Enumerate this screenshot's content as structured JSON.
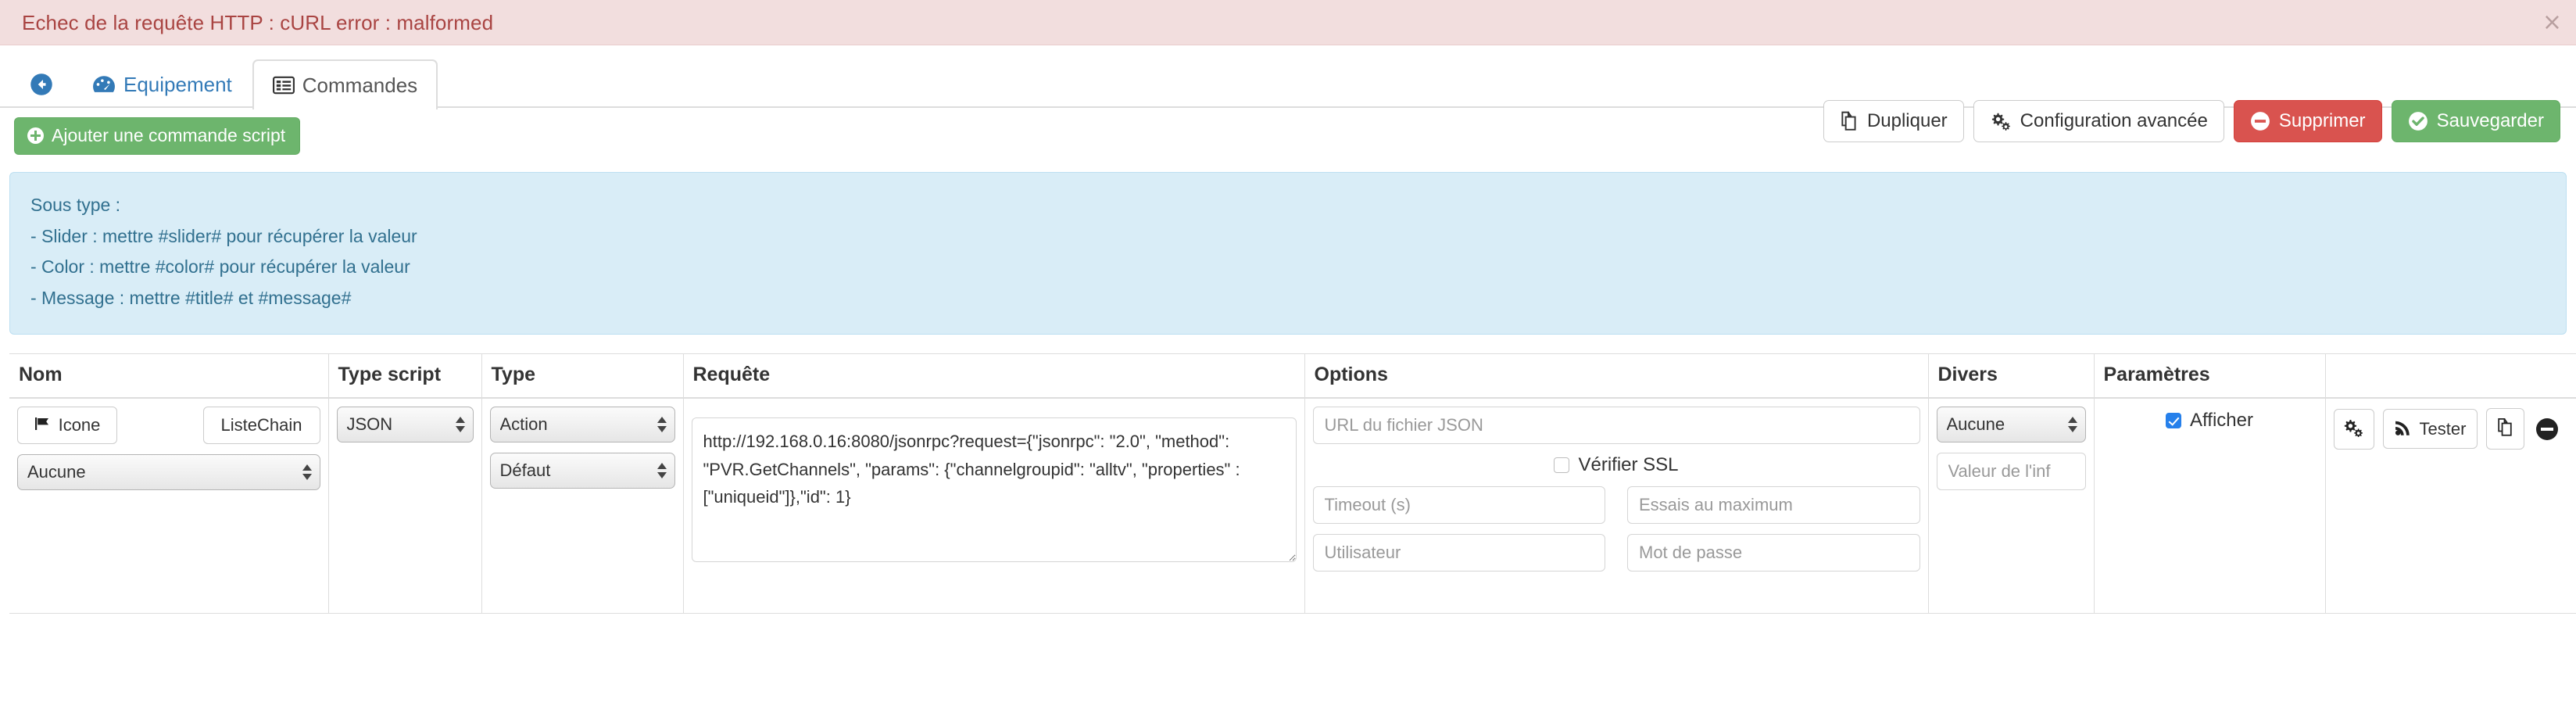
{
  "alert": {
    "message": "Echec de la requête HTTP : cURL error : malformed",
    "close_label": "×",
    "bg_color": "#f2dede",
    "text_color": "#a94442"
  },
  "tabs": [
    {
      "name": "back",
      "label": "",
      "icon": "arrow-circle-left-icon",
      "active": false
    },
    {
      "name": "equipement",
      "label": "Equipement",
      "icon": "dashboard-icon",
      "active": false
    },
    {
      "name": "commandes",
      "label": "Commandes",
      "icon": "list-alt-icon",
      "active": true
    }
  ],
  "header_actions": [
    {
      "name": "dupliquer",
      "label": "Dupliquer",
      "icon": "copy-icon",
      "style": "default"
    },
    {
      "name": "configuration-avancee",
      "label": "Configuration avancée",
      "icon": "cogs-icon",
      "style": "default"
    },
    {
      "name": "supprimer",
      "label": "Supprimer",
      "icon": "minus-circle-icon",
      "style": "danger"
    },
    {
      "name": "sauvegarder",
      "label": "Sauvegarder",
      "icon": "check-circle-icon",
      "style": "success"
    }
  ],
  "add_button": {
    "label": "Ajouter une commande script",
    "icon": "plus-circle-icon"
  },
  "info_panel": {
    "line1": "Sous type :",
    "line2": "- Slider : mettre #slider# pour récupérer la valeur",
    "line3": "- Color : mettre #color# pour récupérer la valeur",
    "line4": "- Message : mettre #title# et #message#",
    "bg_color": "#d9edf7",
    "text_color": "#31708f"
  },
  "table": {
    "headers": {
      "nom": "Nom",
      "type_script": "Type script",
      "type": "Type",
      "requete": "Requête",
      "options": "Options",
      "divers": "Divers",
      "parametres": "Paramètres",
      "actions": ""
    },
    "row": {
      "nom": {
        "icone_button": "Icone",
        "liste_button": "ListeChain",
        "select_value": "Aucune"
      },
      "type_script": {
        "select_value": "JSON"
      },
      "type": {
        "select_value": "Action",
        "subtype_value": "Défaut"
      },
      "requete": {
        "value": "http://192.168.0.16:8080/jsonrpc?request={\"jsonrpc\": \"2.0\", \"method\": \"PVR.GetChannels\", \"params\": {\"channelgroupid\": \"alltv\", \"properties\" :[\"uniqueid\"]},\"id\": 1}"
      },
      "options": {
        "url_placeholder": "URL du fichier JSON",
        "url_value": "",
        "ssl_label": "Vérifier SSL",
        "ssl_checked": false,
        "timeout_placeholder": "Timeout (s)",
        "timeout_value": "",
        "retries_placeholder": "Essais au maximum",
        "retries_value": "",
        "user_placeholder": "Utilisateur",
        "user_value": "",
        "password_placeholder": "Mot de passe",
        "password_value": ""
      },
      "divers": {
        "select_value": "Aucune",
        "info_placeholder": "Valeur de l'inf",
        "info_value": ""
      },
      "parametres": {
        "afficher_label": "Afficher",
        "afficher_checked": true,
        "checkbox_color": "#2680eb"
      },
      "actions": [
        {
          "name": "configuration",
          "label": "",
          "icon": "cogs-icon"
        },
        {
          "name": "tester",
          "label": "Tester",
          "icon": "rss-icon"
        },
        {
          "name": "dupliquer-commande",
          "label": "",
          "icon": "copy-icon"
        },
        {
          "name": "supprimer-commande",
          "label": "",
          "icon": "minus-circle-icon"
        }
      ]
    }
  }
}
